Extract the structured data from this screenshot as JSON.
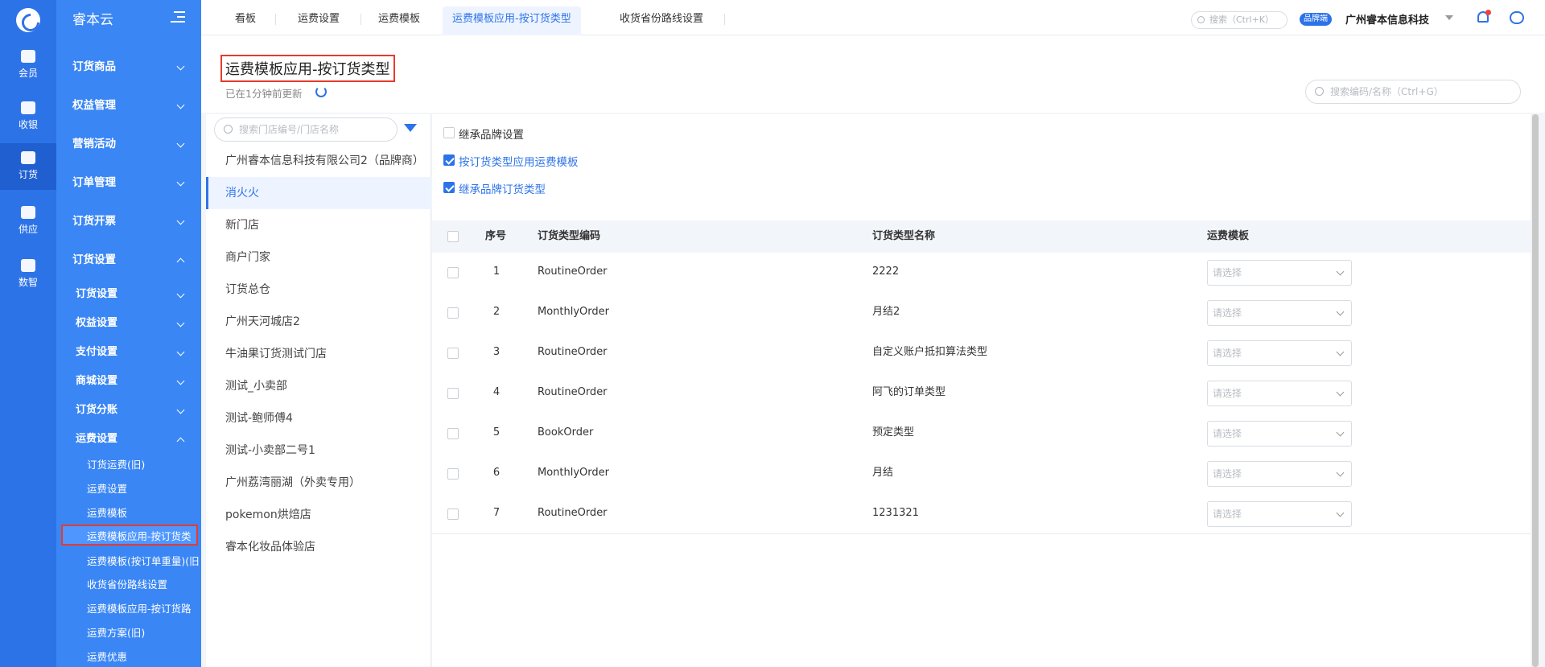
{
  "rail": {
    "items": [
      {
        "label": "会员"
      },
      {
        "label": "收银"
      },
      {
        "label": "订货"
      },
      {
        "label": "供应"
      },
      {
        "label": "数智"
      }
    ]
  },
  "sidebar": {
    "brand": "睿本云",
    "top_items": [
      {
        "label": "订货商品"
      },
      {
        "label": "权益管理"
      },
      {
        "label": "营销活动"
      },
      {
        "label": "订单管理"
      },
      {
        "label": "订货开票"
      },
      {
        "label": "订货设置"
      }
    ],
    "sub_items": [
      {
        "label": "订货设置"
      },
      {
        "label": "权益设置"
      },
      {
        "label": "支付设置"
      },
      {
        "label": "商城设置"
      },
      {
        "label": "订货分账"
      },
      {
        "label": "运费设置"
      }
    ],
    "leaf_items": [
      {
        "label": "订货运费(旧)"
      },
      {
        "label": "运费设置"
      },
      {
        "label": "运费模板"
      },
      {
        "label": "运费模板应用-按订货类"
      },
      {
        "label": "运费模板(按订单重量)(旧"
      },
      {
        "label": "收货省份路线设置"
      },
      {
        "label": "运费模板应用-按订货路"
      },
      {
        "label": "运费方案(旧)"
      },
      {
        "label": "运费优惠"
      }
    ]
  },
  "topbar": {
    "tabs": [
      {
        "label": "看板"
      },
      {
        "label": "运费设置"
      },
      {
        "label": "运费模板"
      },
      {
        "label": "运费模板应用-按订货类型"
      },
      {
        "label": "收货省份路线设置"
      }
    ],
    "search_placeholder": "搜索（Ctrl+K）",
    "brand_badge": "品牌端",
    "company": "广州睿本信息科技"
  },
  "page": {
    "title": "运费模板应用-按订货类型",
    "updated": "已在1分钟前更新",
    "search_placeholder": "搜索编码/名称（Ctrl+G）"
  },
  "stores": {
    "search_placeholder": "搜索门店编号/门店名称",
    "items": [
      {
        "label": "广州睿本信息科技有限公司2（品牌商）"
      },
      {
        "label": "消火火"
      },
      {
        "label": "新门店"
      },
      {
        "label": "商户门家"
      },
      {
        "label": "订货总仓"
      },
      {
        "label": "广州天河城店2"
      },
      {
        "label": "牛油果订货测试门店"
      },
      {
        "label": "测试_小卖部"
      },
      {
        "label": "测试-鲍师傅4"
      },
      {
        "label": "测试-小卖部二号1"
      },
      {
        "label": "广州荔湾丽湖（外卖专用）"
      },
      {
        "label": "pokemon烘焙店"
      },
      {
        "label": "睿本化妆品体验店"
      }
    ]
  },
  "options": [
    {
      "label": "继承品牌设置",
      "checked": false
    },
    {
      "label": "按订货类型应用运费模板",
      "checked": true
    },
    {
      "label": "继承品牌订货类型",
      "checked": true
    }
  ],
  "table": {
    "headers": {
      "index": "序号",
      "code": "订货类型编码",
      "name": "订货类型名称",
      "template": "运费模板"
    },
    "select_placeholder": "请选择",
    "rows": [
      {
        "index": "1",
        "code": "RoutineOrder",
        "name": "2222"
      },
      {
        "index": "2",
        "code": "MonthlyOrder",
        "name": "月结2"
      },
      {
        "index": "3",
        "code": "RoutineOrder",
        "name": "自定义账户抵扣算法类型"
      },
      {
        "index": "4",
        "code": "RoutineOrder",
        "name": "阿飞的订单类型"
      },
      {
        "index": "5",
        "code": "BookOrder",
        "name": "预定类型"
      },
      {
        "index": "6",
        "code": "MonthlyOrder",
        "name": "月结"
      },
      {
        "index": "7",
        "code": "RoutineOrder",
        "name": "1231321"
      }
    ]
  }
}
